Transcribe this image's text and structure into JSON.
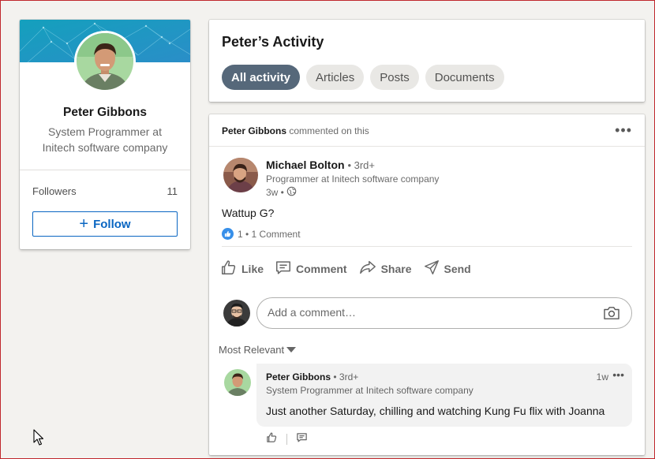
{
  "profile": {
    "name": "Peter Gibbons",
    "title": "System Programmer at Initech software company",
    "followers_label": "Followers",
    "followers_count": "11",
    "follow_label": "Follow"
  },
  "activity": {
    "title": "Peter’s Activity",
    "filters": [
      "All activity",
      "Articles",
      "Posts",
      "Documents"
    ],
    "active_filter": "All activity"
  },
  "post": {
    "header_actor": "Peter Gibbons",
    "header_action": "commented on this",
    "author_name": "Michael Bolton",
    "author_degree": "• 3rd+",
    "author_headline": "Programmer at Initech software company",
    "time": "3w •",
    "text": "Wattup G?",
    "social_counts": "1 • 1 Comment",
    "actions": {
      "like": "Like",
      "comment": "Comment",
      "share": "Share",
      "send": "Send"
    },
    "comment_placeholder": "Add a comment…",
    "sort_label": "Most Relevant"
  },
  "comment": {
    "name": "Peter Gibbons",
    "degree": "• 3rd+",
    "headline": "System Programmer at Initech software company",
    "time": "1w",
    "text": "Just another Saturday, chilling and watching Kung Fu flix with Joanna"
  },
  "colors": {
    "accent": "#0a66c2",
    "active_pill": "#56687a",
    "background": "#f3f2ef",
    "banner": "#1a9bc9"
  }
}
